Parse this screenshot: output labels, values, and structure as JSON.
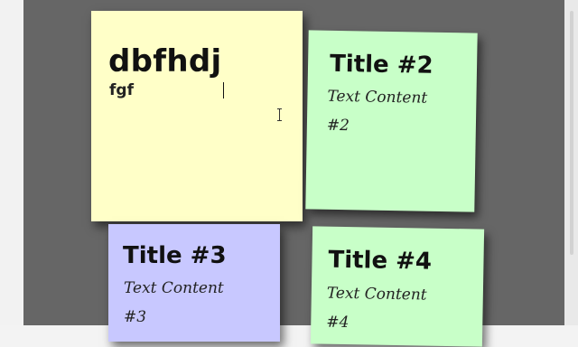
{
  "notes": [
    {
      "title": "dbfhdj",
      "content": "fgf",
      "color": "#ffffc8",
      "editing": true
    },
    {
      "title": "Title #2",
      "content": "Text Content\n#2",
      "color": "#c8ffc8"
    },
    {
      "title": "Title #3",
      "content": "Text Content\n#3",
      "color": "#c8c8ff"
    },
    {
      "title": "Title #4",
      "content": "Text Content\n#4",
      "color": "#c8ffc8"
    }
  ],
  "colors": {
    "board": "#666666",
    "page": "#f2f2f2"
  },
  "cursor": "text-cursor-icon"
}
